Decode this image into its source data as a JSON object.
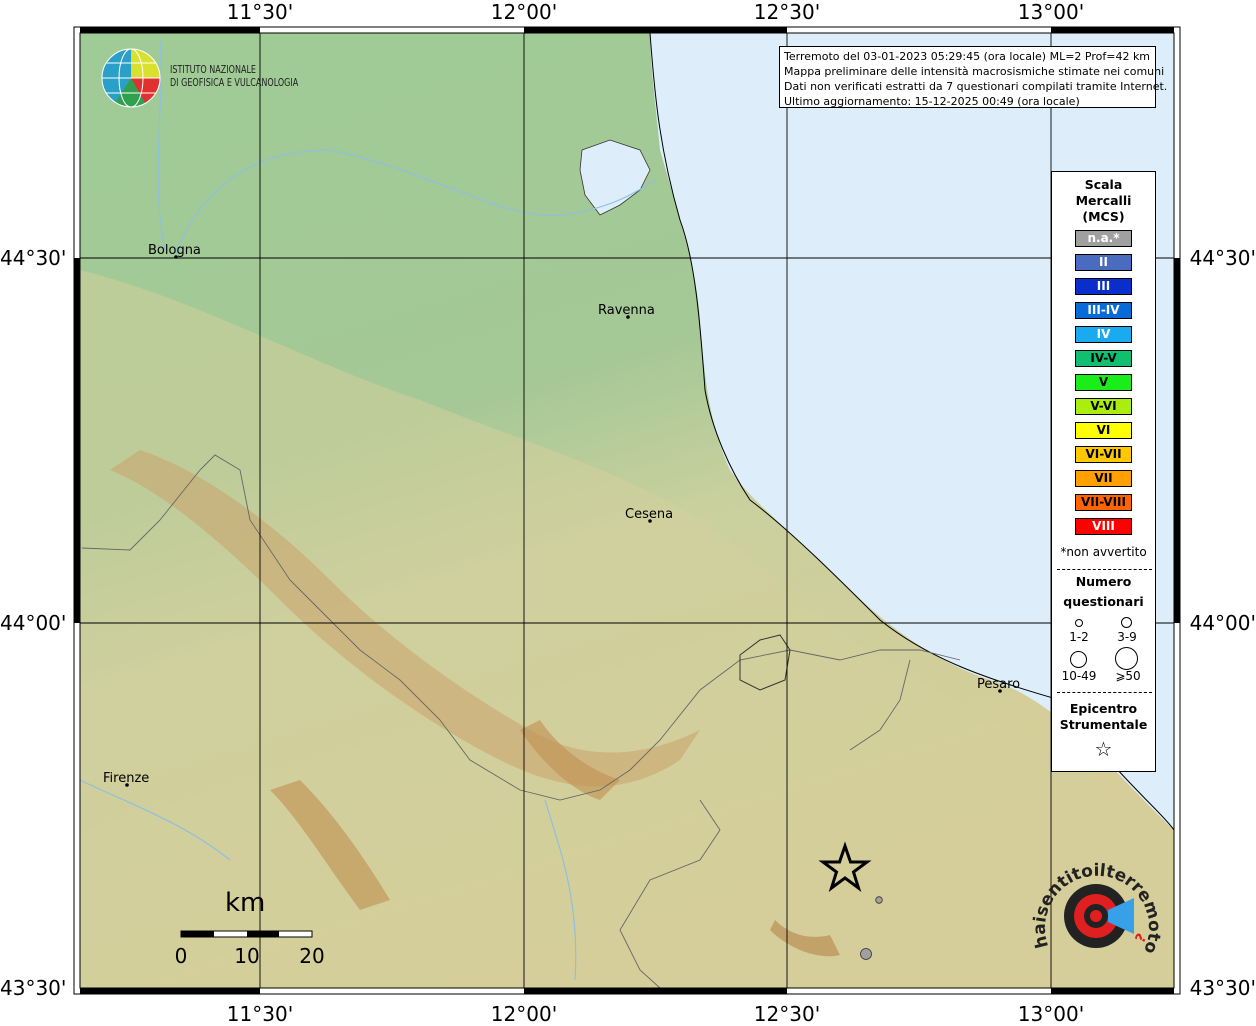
{
  "frame": {
    "top_labels": [
      "11°30'",
      "12°00'",
      "12°30'",
      "13°00'"
    ],
    "bottom_labels": [
      "11°30'",
      "12°00'",
      "12°30'",
      "13°00'"
    ],
    "left_labels": [
      "44°30'",
      "44°00'",
      "43°30'"
    ],
    "right_labels": [
      "44°30'",
      "44°00'",
      "43°30'"
    ]
  },
  "logo": {
    "line1": "ISTITUTO NAZIONALE",
    "line2": "DI GEOFISICA E VULCANOLOGIA"
  },
  "info": {
    "line1": "Terremoto del 03-01-2023 05:29:45 (ora locale) ML=2 Prof=42 km",
    "line2": "Mappa preliminare delle intensità macrosismiche stimate nei comuni",
    "line3": "Dati non verificati estratti da 7 questionari compilati tramite Internet.",
    "line4": "Ultimo aggiornamento: 15-12-2025 00:49 (ora locale)"
  },
  "cities": [
    {
      "name": "Bologna"
    },
    {
      "name": "Ravenna"
    },
    {
      "name": "Cesena"
    },
    {
      "name": "Pesaro"
    },
    {
      "name": "Firenze"
    }
  ],
  "legend": {
    "title1": "Scala",
    "title2": "Mercalli",
    "title3": "(MCS)",
    "classes": [
      {
        "label": "n.a.*",
        "color": "#a0a0a0",
        "text": "#ffffff"
      },
      {
        "label": "II",
        "color": "#4a6cc0",
        "text": "#ffffff"
      },
      {
        "label": "III",
        "color": "#0a2ecc",
        "text": "#ffffff"
      },
      {
        "label": "III-IV",
        "color": "#0a6ad8",
        "text": "#ffffff"
      },
      {
        "label": "IV",
        "color": "#1aaaf0",
        "text": "#ffffff"
      },
      {
        "label": "IV-V",
        "color": "#10c070",
        "text": "#000000"
      },
      {
        "label": "V",
        "color": "#1aee1a",
        "text": "#000000"
      },
      {
        "label": "V-VI",
        "color": "#aaee10",
        "text": "#000000"
      },
      {
        "label": "VI",
        "color": "#ffff00",
        "text": "#000000"
      },
      {
        "label": "VI-VII",
        "color": "#ffc800",
        "text": "#000000"
      },
      {
        "label": "VII",
        "color": "#ffa000",
        "text": "#000000"
      },
      {
        "label": "VII-VIII",
        "color": "#ff6400",
        "text": "#000000"
      },
      {
        "label": "VIII",
        "color": "#ff0000",
        "text": "#ffffff"
      }
    ],
    "note": "*non avvertito",
    "count_title1": "Numero",
    "count_title2": "questionari",
    "counts": [
      "1-2",
      "3-9",
      "10-49",
      "⩾50"
    ],
    "epi_title1": "Epicentro",
    "epi_title2": "Strumentale",
    "epi_symbol": "☆"
  },
  "scalebar": {
    "unit": "km",
    "ticks": [
      "0",
      "10",
      "20"
    ]
  },
  "epicenter": {
    "symbol": "star-icon"
  },
  "reports": [
    {
      "count_class": "1-2",
      "intensity": "n.a.*"
    },
    {
      "count_class": "3-9",
      "intensity": "n.a.*"
    }
  ],
  "badge": {
    "text": "haisentitoilterremoto.it",
    "www": "www.",
    "question": "?"
  },
  "colors": {
    "sea": "#ddeefa",
    "plain": "#a6cb9e",
    "hills": "#d8cf9a",
    "mountains": "#c49a5c",
    "grid": "#000000"
  }
}
